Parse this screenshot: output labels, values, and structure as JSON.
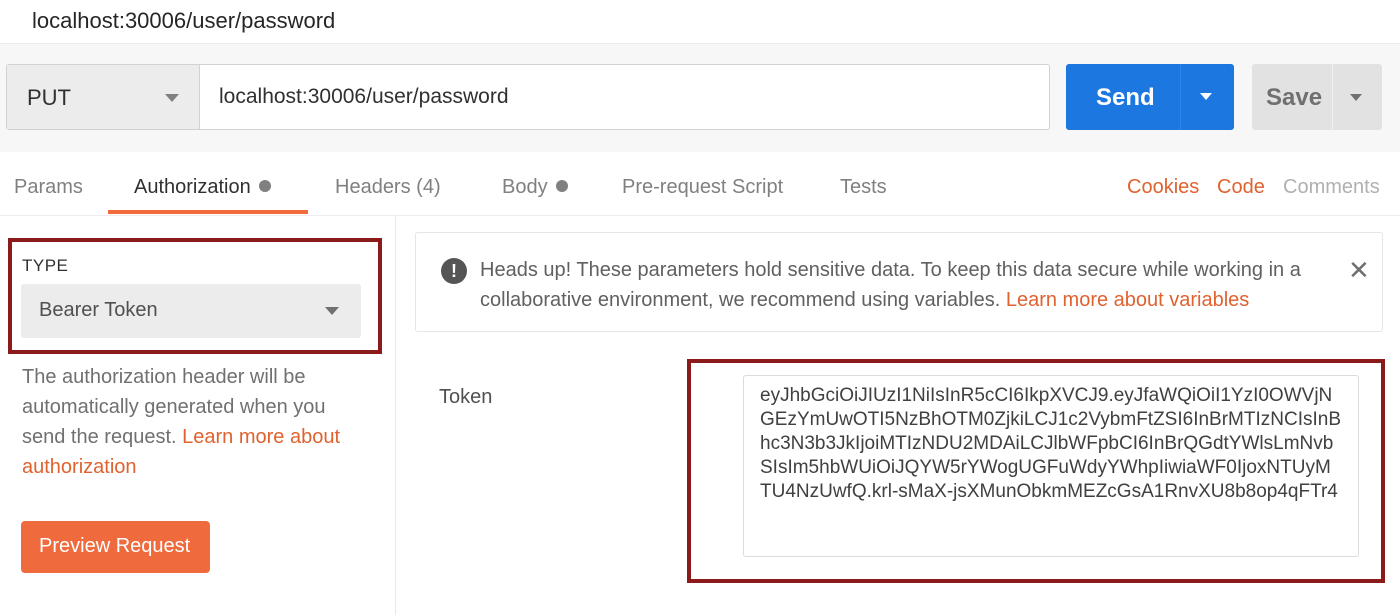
{
  "window": {
    "title": "localhost:30006/user/password"
  },
  "request": {
    "method": "PUT",
    "url": "localhost:30006/user/password",
    "send_label": "Send",
    "save_label": "Save"
  },
  "tabs": [
    {
      "label": "Params"
    },
    {
      "label": "Authorization"
    },
    {
      "label": "Headers",
      "count": "(4)"
    },
    {
      "label": "Body"
    },
    {
      "label": "Pre-request Script"
    },
    {
      "label": "Tests"
    }
  ],
  "tab_links": {
    "cookies": "Cookies",
    "code": "Code",
    "comments": "Comments"
  },
  "auth": {
    "type_label": "TYPE",
    "type_value": "Bearer Token",
    "description": "The authorization header will be automatically generated when you send the request.",
    "learn_more": "Learn more about authorization",
    "preview_button": "Preview Request"
  },
  "warning": {
    "icon": "exclamation-icon",
    "text": "Heads up! These parameters hold sensitive data. To keep this data secure while working in a collaborative environment, we recommend using variables.",
    "link": "Learn more about variables"
  },
  "token": {
    "label": "Token",
    "value": "eyJhbGciOiJIUzI1NiIsInR5cCI6IkpXVCJ9.eyJfaWQiOiI1YzI0OWVjNGEzYmUwOTI5NzBhOTM0ZjkiLCJ1c2VybmFtZSI6InBrMTIzNCIsInBhc3N3b3JkIjoiMTIzNDU2MDAiLCJlbWFpbCI6InBrQGdtYWlsLmNvbSIsIm5hbWUiOiJQYW5rYWogUGFuWdyYWhpIiwiaWF0IjoxNTUyMTU4NzUwfQ.krl-sMaX-jsXMunObkmMEZcGsA1RnvXU8b8op4qFTr4"
  },
  "colors": {
    "accent": "#f26b3a",
    "send": "#1c77e0",
    "highlight_border": "#8b1a1a"
  }
}
